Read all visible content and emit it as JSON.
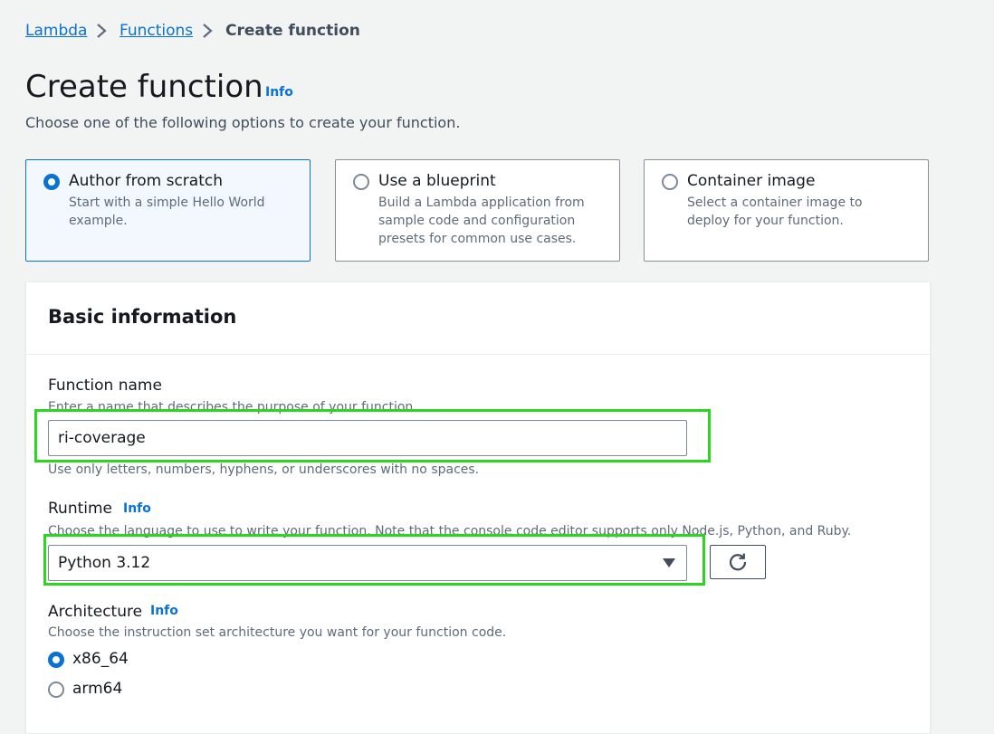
{
  "breadcrumb": {
    "items": [
      "Lambda",
      "Functions"
    ],
    "current": "Create function"
  },
  "header": {
    "title": "Create function",
    "info": "Info",
    "subtitle": "Choose one of the following options to create your function."
  },
  "options": [
    {
      "title": "Author from scratch",
      "description": "Start with a simple Hello World example.",
      "selected": true
    },
    {
      "title": "Use a blueprint",
      "description": "Build a Lambda application from sample code and configuration presets for common use cases.",
      "selected": false
    },
    {
      "title": "Container image",
      "description": "Select a container image to deploy for your function.",
      "selected": false
    }
  ],
  "basic_info": {
    "title": "Basic information",
    "function_name": {
      "label": "Function name",
      "description": "Enter a name that describes the purpose of your function.",
      "value": "ri-coverage",
      "constraint": "Use only letters, numbers, hyphens, or underscores with no spaces."
    },
    "runtime": {
      "label": "Runtime",
      "info": "Info",
      "description": "Choose the language to use to write your function. Note that the console code editor supports only Node.js, Python, and Ruby.",
      "value": "Python 3.12"
    },
    "architecture": {
      "label": "Architecture",
      "info": "Info",
      "description": "Choose the instruction set architecture you want for your function code.",
      "options": [
        {
          "label": "x86_64",
          "selected": true
        },
        {
          "label": "arm64",
          "selected": false
        }
      ]
    }
  },
  "icons": {
    "breadcrumb_separator": "chevron-right-icon",
    "runtime_dropdown": "caret-down-icon",
    "refresh": "refresh-icon"
  },
  "colors": {
    "accent": "#0972d3",
    "highlight": "#2bd61f",
    "background": "#f2f3f3"
  }
}
